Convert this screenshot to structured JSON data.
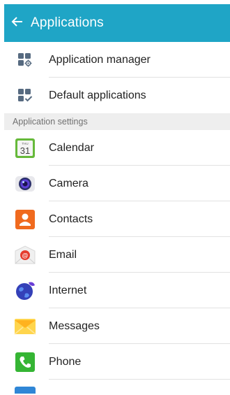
{
  "header": {
    "title": "Applications"
  },
  "top_items": [
    {
      "label": "Application manager",
      "icon": "app-manager-icon"
    },
    {
      "label": "Default applications",
      "icon": "default-apps-icon"
    }
  ],
  "section": {
    "label": "Application settings"
  },
  "apps": [
    {
      "label": "Calendar",
      "icon": "calendar-icon",
      "calendar_day": "THU",
      "calendar_date": "31"
    },
    {
      "label": "Camera",
      "icon": "camera-icon"
    },
    {
      "label": "Contacts",
      "icon": "contacts-icon"
    },
    {
      "label": "Email",
      "icon": "email-icon"
    },
    {
      "label": "Internet",
      "icon": "internet-icon"
    },
    {
      "label": "Messages",
      "icon": "messages-icon"
    },
    {
      "label": "Phone",
      "icon": "phone-icon"
    }
  ],
  "colors": {
    "header": "#1fa5c6",
    "section_bg": "#eeeeee",
    "text": "#222222"
  }
}
